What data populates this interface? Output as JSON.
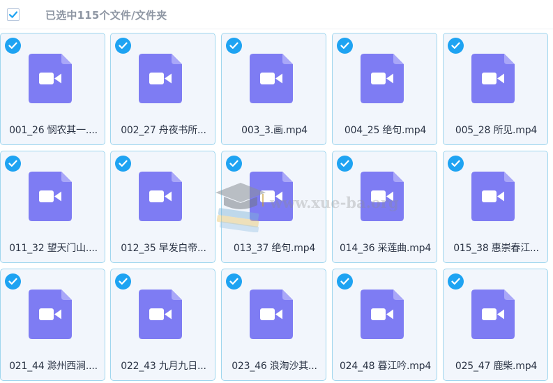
{
  "header": {
    "select_all_checked": true,
    "selection_text": "已选中115个文件/文件夹"
  },
  "files": [
    {
      "name": "001_26 悯农其一....",
      "selected": true,
      "type": "video"
    },
    {
      "name": "002_27 舟夜书所...",
      "selected": true,
      "type": "video"
    },
    {
      "name": "003_3.画.mp4",
      "selected": true,
      "type": "video"
    },
    {
      "name": "004_25 绝句.mp4",
      "selected": true,
      "type": "video"
    },
    {
      "name": "005_28 所见.mp4",
      "selected": true,
      "type": "video"
    },
    {
      "name": "011_32 望天门山....",
      "selected": true,
      "type": "video"
    },
    {
      "name": "012_35 早发白帝...",
      "selected": true,
      "type": "video"
    },
    {
      "name": "013_37 绝句.mp4",
      "selected": true,
      "type": "video"
    },
    {
      "name": "014_36 采莲曲.mp4",
      "selected": true,
      "type": "video"
    },
    {
      "name": "015_38 惠崇春江...",
      "selected": true,
      "type": "video"
    },
    {
      "name": "021_44 滁州西涧....",
      "selected": true,
      "type": "video"
    },
    {
      "name": "022_43 九月九日...",
      "selected": true,
      "type": "video"
    },
    {
      "name": "023_46 浪淘沙其...",
      "selected": true,
      "type": "video"
    },
    {
      "name": "024_48 暮江吟.mp4",
      "selected": true,
      "type": "video"
    },
    {
      "name": "025_47 鹿柴.mp4",
      "selected": true,
      "type": "video"
    }
  ],
  "icons": {
    "file": "video-file-icon",
    "check": "check-icon"
  },
  "colors": {
    "accent": "#1ea3f2",
    "file_icon": "#7e7cf3",
    "card_border": "#9fd6ee",
    "card_bg": "#f2f6fc"
  },
  "watermark": {
    "text": "www.xue-ba.org"
  }
}
